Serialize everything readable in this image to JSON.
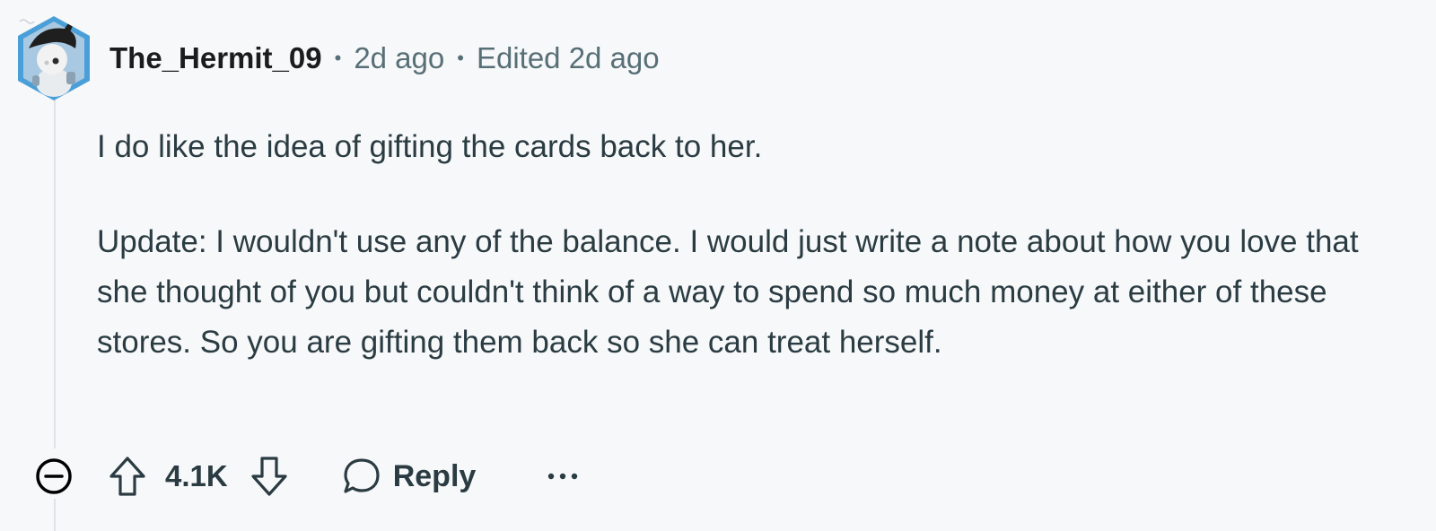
{
  "comment": {
    "author": "The_Hermit_09",
    "posted": "2d ago",
    "edited": "Edited 2d ago",
    "separator": "•",
    "paragraphs": [
      "I do like the idea of gifting the cards back to her.",
      "Update: I wouldn't use any of the balance. I would just write a note about how you love that she thought of you but couldn't think of a way to spend so much money at either of these stores. So you are gifting them back so she can treat herself."
    ]
  },
  "actions": {
    "score": "4.1K",
    "reply_label": "Reply",
    "icons": {
      "collapse": "minus-circle-icon",
      "upvote": "arrow-up-icon",
      "downvote": "arrow-down-icon",
      "reply": "speech-bubble-icon",
      "more": "ellipsis-icon"
    }
  },
  "colors": {
    "background": "#f7f8fa",
    "text": "#1c1c1c",
    "body_text": "#2a3c42",
    "meta_text": "#576f76",
    "thread_line": "#dfe3e8",
    "avatar_accent": "#4a9fd8"
  }
}
